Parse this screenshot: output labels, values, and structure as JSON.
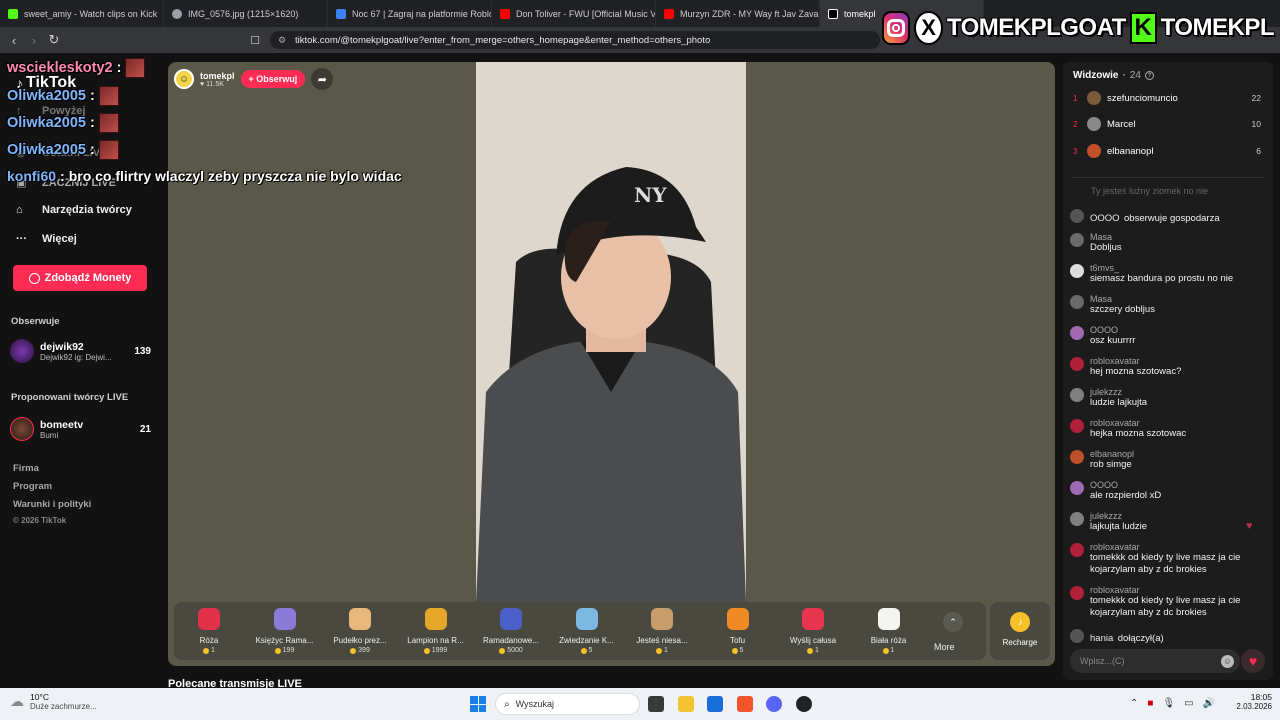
{
  "browser": {
    "tabs": [
      {
        "label": "sweet_amiy - Watch clips on Kick",
        "color": "#53fc18"
      },
      {
        "label": "IMG_0576.jpg (1215×1620)",
        "color": "#9aa0a6"
      },
      {
        "label": "Noc 67 | Zagraj na platformie Roblox",
        "color": "#3b82f6"
      },
      {
        "label": "Don Toliver - FWU [Official Music Vid",
        "color": "#ff0000"
      },
      {
        "label": "Murzyn ZDR - MY Way ft Jav Zavari",
        "color": "#ff0000"
      },
      {
        "label": "tomekpl",
        "color": "#ffffff"
      }
    ],
    "url": "tiktok.com/@tomekplgoat/live?enter_from_merge=others_homepage&enter_method=others_photo"
  },
  "brand_overlay": {
    "instagram_name": "TOMEKPLGOAT",
    "kick_name": "TOMEKPL",
    "kick_letter": "K"
  },
  "sidebar": {
    "logo": "TikTok",
    "items": [
      {
        "label": "Powyżej"
      },
      {
        "label": "Ostatni LIVE"
      },
      {
        "label": "ZACZNIJ LIVE"
      },
      {
        "label": "Narzędzia twórcy"
      },
      {
        "label": "Więcej"
      }
    ],
    "coins_button": "Zdobądź Monety",
    "following_label": "Obserwuje",
    "following": [
      {
        "name": "dejwik92",
        "sub": "Dejwik92 ig: Dejwi...",
        "count": "139"
      }
    ],
    "suggested_label": "Proponowani twórcy LIVE",
    "suggested": [
      {
        "name": "bomeetv",
        "sub": "Bumi",
        "count": "21"
      }
    ],
    "footer": [
      "Firma",
      "Program",
      "Warunki i polityki",
      "© 2026 TikTok"
    ],
    "recommended_heading": "Polecane transmisje LIVE"
  },
  "overlay_chat": [
    {
      "user": "wsciekleskoty2",
      "text": "",
      "emote": true
    },
    {
      "user": "Oliwka2005",
      "text": "",
      "emote": true
    },
    {
      "user": "Oliwka2005",
      "text": "",
      "emote": true
    },
    {
      "user": "Oliwka2005",
      "text": "",
      "emote": true
    },
    {
      "user": "konfi60",
      "text": "bro co flirtry wlaczyl zeby pryszcza nie bylo widac",
      "emote": false
    }
  ],
  "stream": {
    "host_name": "tomekpl",
    "host_likes": "11.5K",
    "follow_label": "+ Obserwuj",
    "gifts": [
      {
        "name": "Róża",
        "price": "1",
        "color": "#e0304a"
      },
      {
        "name": "Księżyc Rama...",
        "price": "199",
        "color": "#8a7bd6"
      },
      {
        "name": "Pudełko prez...",
        "price": "399",
        "color": "#e8b87a"
      },
      {
        "name": "Lampion na R...",
        "price": "1999",
        "color": "#e6a62a"
      },
      {
        "name": "Ramadanowe...",
        "price": "5000",
        "color": "#4a5fc8"
      },
      {
        "name": "Zwiedzanie K...",
        "price": "5",
        "color": "#7db8e0"
      },
      {
        "name": "Jesteś niesa...",
        "price": "1",
        "color": "#c89c6a"
      },
      {
        "name": "Tofu",
        "price": "5",
        "color": "#f08a24"
      },
      {
        "name": "Wyślij całusa",
        "price": "1",
        "color": "#e8344e"
      },
      {
        "name": "Biała róża",
        "price": "1",
        "color": "#f4f4f0"
      }
    ],
    "more_label": "More",
    "recharge_label": "Recharge"
  },
  "viewers": {
    "title": "Widzowie",
    "count": "24",
    "top": [
      {
        "rank": "1",
        "name": "szefunciomuncio",
        "score": "22",
        "color": "#7a5a3a"
      },
      {
        "rank": "2",
        "name": "Marcel",
        "score": "10",
        "color": "#888888"
      },
      {
        "rank": "3",
        "name": "elbananopl",
        "score": "6",
        "color": "#c0502a"
      }
    ]
  },
  "chat": {
    "partial_line": "Ty jesteś luźny ziomek no nie",
    "messages": [
      {
        "user": "OOOO",
        "text": "obserwuje gospodarza",
        "inline": true,
        "color": "#555555"
      },
      {
        "user": "Masa",
        "text": "Dobljus",
        "inline": false,
        "color": "#6a6a6a"
      },
      {
        "user": "t6mvs_",
        "text": "siemasz bandura po prostu no nie",
        "inline": false,
        "color": "#dddddd"
      },
      {
        "user": "Masa",
        "text": "szczery dobljus",
        "inline": false,
        "color": "#6a6a6a"
      },
      {
        "user": "OOOO",
        "text": "osz kuurrrr",
        "inline": false,
        "color": "#a06ab0"
      },
      {
        "user": "robloxavatar",
        "text": "hej mozna szotowac?",
        "inline": false,
        "color": "#b0203a"
      },
      {
        "user": "julekzzz",
        "text": "ludzie lajkujta",
        "inline": false,
        "color": "#808080"
      },
      {
        "user": "robloxavatar",
        "text": "hejka mozna szotowac",
        "inline": false,
        "color": "#b0203a"
      },
      {
        "user": "elbananopl",
        "text": "rob simge",
        "inline": false,
        "color": "#c0502a"
      },
      {
        "user": "OOOO",
        "text": "ale rozpierdol xD",
        "inline": false,
        "color": "#a06ab0"
      },
      {
        "user": "julekzzz",
        "text": "lajkujta ludzie",
        "inline": false,
        "color": "#808080"
      },
      {
        "user": "robloxavatar",
        "text": "tomekkk od kiedy ty live masz ja cie kojarzylam aby z dc brokies",
        "inline": false,
        "color": "#b0203a"
      },
      {
        "user": "robloxavatar",
        "text": "tomekkk od kiedy ty live masz ja cie kojarzylam aby z dc brokies",
        "inline": false,
        "color": "#b0203a"
      },
      {
        "user": "hania",
        "text": "dołączył(a)",
        "inline": true,
        "color": "#555555"
      }
    ],
    "input_placeholder": "Wpisz...(C)"
  },
  "taskbar": {
    "weather_temp": "10°C",
    "weather_desc": "Duże zachmurze...",
    "search_placeholder": "Wyszukaj",
    "time": "18:05",
    "date": "2.03.2026"
  }
}
